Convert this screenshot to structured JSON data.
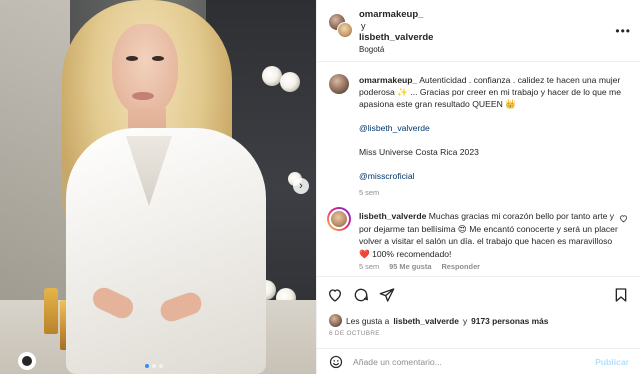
{
  "post": {
    "author": "omarmakeup_",
    "coauthor_joiner": "y",
    "coauthor": "lisbeth_valverde",
    "location": "Bogotá",
    "more_icon": "more-horizontal-icon"
  },
  "caption": {
    "username": "omarmakeup_",
    "line1": "Autenticidad . confianza . calidez te hacen una mujer poderosa",
    "line1_emoji": "✨",
    "line2": "... Gracias por creer en mi trabajo y hacer de lo que me apasiona este gran resultado QUEEN",
    "line2_emoji": "👑",
    "mention1": "@lisbeth_valverde",
    "title": "Miss Universe Costa Rica 2023",
    "mention2": "@misscroficial",
    "time": "5 sem"
  },
  "comment": {
    "username": "lisbeth_valverde",
    "text_a": "Muchas gracias mi corazón bello por tanto arte y por dejarme tan bellísima",
    "emoji_a": "😍",
    "text_b": "Me encantó conocerte y será un placer volver a visitar el salón un día. el trabajo que hacen es maravilloso",
    "emoji_b": "❤️",
    "text_c": "100% recomendado!",
    "time": "5 sem",
    "likes": "95 Me gusta",
    "reply": "Responder"
  },
  "likes": {
    "prefix": "Les gusta a",
    "user": "lisbeth_valverde",
    "joiner": "y",
    "count": "9173 personas más"
  },
  "date": "6 DE OCTUBRE",
  "add_comment": {
    "placeholder": "Añade un comentario...",
    "post_label": "Publicar"
  },
  "colors": {
    "link": "#00376b",
    "muted": "#8e8e8e",
    "publish": "#b2dffc",
    "carousel_active": "#3a8df0"
  }
}
